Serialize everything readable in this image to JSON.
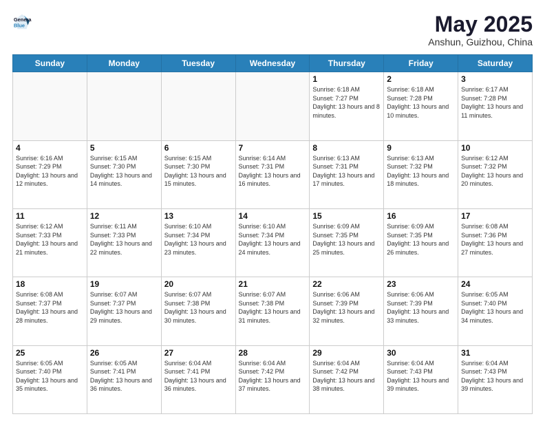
{
  "header": {
    "logo_line1": "General",
    "logo_line2": "Blue",
    "month": "May 2025",
    "location": "Anshun, Guizhou, China"
  },
  "weekdays": [
    "Sunday",
    "Monday",
    "Tuesday",
    "Wednesday",
    "Thursday",
    "Friday",
    "Saturday"
  ],
  "weeks": [
    [
      {
        "day": "",
        "info": ""
      },
      {
        "day": "",
        "info": ""
      },
      {
        "day": "",
        "info": ""
      },
      {
        "day": "",
        "info": ""
      },
      {
        "day": "1",
        "info": "Sunrise: 6:18 AM\nSunset: 7:27 PM\nDaylight: 13 hours and 8 minutes."
      },
      {
        "day": "2",
        "info": "Sunrise: 6:18 AM\nSunset: 7:28 PM\nDaylight: 13 hours and 10 minutes."
      },
      {
        "day": "3",
        "info": "Sunrise: 6:17 AM\nSunset: 7:28 PM\nDaylight: 13 hours and 11 minutes."
      }
    ],
    [
      {
        "day": "4",
        "info": "Sunrise: 6:16 AM\nSunset: 7:29 PM\nDaylight: 13 hours and 12 minutes."
      },
      {
        "day": "5",
        "info": "Sunrise: 6:15 AM\nSunset: 7:30 PM\nDaylight: 13 hours and 14 minutes."
      },
      {
        "day": "6",
        "info": "Sunrise: 6:15 AM\nSunset: 7:30 PM\nDaylight: 13 hours and 15 minutes."
      },
      {
        "day": "7",
        "info": "Sunrise: 6:14 AM\nSunset: 7:31 PM\nDaylight: 13 hours and 16 minutes."
      },
      {
        "day": "8",
        "info": "Sunrise: 6:13 AM\nSunset: 7:31 PM\nDaylight: 13 hours and 17 minutes."
      },
      {
        "day": "9",
        "info": "Sunrise: 6:13 AM\nSunset: 7:32 PM\nDaylight: 13 hours and 18 minutes."
      },
      {
        "day": "10",
        "info": "Sunrise: 6:12 AM\nSunset: 7:32 PM\nDaylight: 13 hours and 20 minutes."
      }
    ],
    [
      {
        "day": "11",
        "info": "Sunrise: 6:12 AM\nSunset: 7:33 PM\nDaylight: 13 hours and 21 minutes."
      },
      {
        "day": "12",
        "info": "Sunrise: 6:11 AM\nSunset: 7:33 PM\nDaylight: 13 hours and 22 minutes."
      },
      {
        "day": "13",
        "info": "Sunrise: 6:10 AM\nSunset: 7:34 PM\nDaylight: 13 hours and 23 minutes."
      },
      {
        "day": "14",
        "info": "Sunrise: 6:10 AM\nSunset: 7:34 PM\nDaylight: 13 hours and 24 minutes."
      },
      {
        "day": "15",
        "info": "Sunrise: 6:09 AM\nSunset: 7:35 PM\nDaylight: 13 hours and 25 minutes."
      },
      {
        "day": "16",
        "info": "Sunrise: 6:09 AM\nSunset: 7:35 PM\nDaylight: 13 hours and 26 minutes."
      },
      {
        "day": "17",
        "info": "Sunrise: 6:08 AM\nSunset: 7:36 PM\nDaylight: 13 hours and 27 minutes."
      }
    ],
    [
      {
        "day": "18",
        "info": "Sunrise: 6:08 AM\nSunset: 7:37 PM\nDaylight: 13 hours and 28 minutes."
      },
      {
        "day": "19",
        "info": "Sunrise: 6:07 AM\nSunset: 7:37 PM\nDaylight: 13 hours and 29 minutes."
      },
      {
        "day": "20",
        "info": "Sunrise: 6:07 AM\nSunset: 7:38 PM\nDaylight: 13 hours and 30 minutes."
      },
      {
        "day": "21",
        "info": "Sunrise: 6:07 AM\nSunset: 7:38 PM\nDaylight: 13 hours and 31 minutes."
      },
      {
        "day": "22",
        "info": "Sunrise: 6:06 AM\nSunset: 7:39 PM\nDaylight: 13 hours and 32 minutes."
      },
      {
        "day": "23",
        "info": "Sunrise: 6:06 AM\nSunset: 7:39 PM\nDaylight: 13 hours and 33 minutes."
      },
      {
        "day": "24",
        "info": "Sunrise: 6:05 AM\nSunset: 7:40 PM\nDaylight: 13 hours and 34 minutes."
      }
    ],
    [
      {
        "day": "25",
        "info": "Sunrise: 6:05 AM\nSunset: 7:40 PM\nDaylight: 13 hours and 35 minutes."
      },
      {
        "day": "26",
        "info": "Sunrise: 6:05 AM\nSunset: 7:41 PM\nDaylight: 13 hours and 36 minutes."
      },
      {
        "day": "27",
        "info": "Sunrise: 6:04 AM\nSunset: 7:41 PM\nDaylight: 13 hours and 36 minutes."
      },
      {
        "day": "28",
        "info": "Sunrise: 6:04 AM\nSunset: 7:42 PM\nDaylight: 13 hours and 37 minutes."
      },
      {
        "day": "29",
        "info": "Sunrise: 6:04 AM\nSunset: 7:42 PM\nDaylight: 13 hours and 38 minutes."
      },
      {
        "day": "30",
        "info": "Sunrise: 6:04 AM\nSunset: 7:43 PM\nDaylight: 13 hours and 39 minutes."
      },
      {
        "day": "31",
        "info": "Sunrise: 6:04 AM\nSunset: 7:43 PM\nDaylight: 13 hours and 39 minutes."
      }
    ]
  ]
}
